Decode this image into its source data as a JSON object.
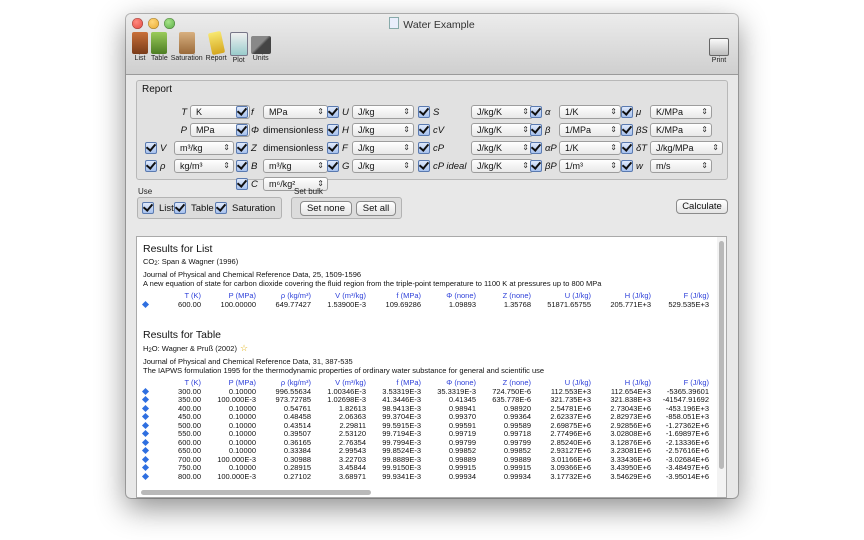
{
  "window": {
    "title": "Water Example"
  },
  "toolbar": {
    "items": [
      {
        "label": "List",
        "icon": "list-icon"
      },
      {
        "label": "Table",
        "icon": "table-icon"
      },
      {
        "label": "Saturation",
        "icon": "saturation-icon"
      },
      {
        "label": "Report",
        "icon": "report-icon"
      },
      {
        "label": "Plot",
        "icon": "plot-icon"
      },
      {
        "label": "Units",
        "icon": "units-icon"
      }
    ],
    "print_label": "Print"
  },
  "report": {
    "title": "Report",
    "T": {
      "label": "T",
      "unit": "K"
    },
    "P": {
      "label": "P",
      "unit": "MPa"
    },
    "V": {
      "label": "V",
      "unit": "m³/kg"
    },
    "rho": {
      "label": "ρ",
      "unit": "kg/m³"
    },
    "f": {
      "label": "f",
      "unit": "MPa"
    },
    "phi": {
      "label": "Φ",
      "text": "dimensionless"
    },
    "Z": {
      "label": "Z",
      "text": "dimensionless"
    },
    "B": {
      "label": "B",
      "unit": "m³/kg"
    },
    "C": {
      "label": "C",
      "unit": "m⁶/kg²"
    },
    "U": {
      "label": "U",
      "unit": "J/kg"
    },
    "H": {
      "label": "H",
      "unit": "J/kg"
    },
    "F": {
      "label": "F",
      "unit": "J/kg"
    },
    "G": {
      "label": "G",
      "unit": "J/kg"
    },
    "S": {
      "label": "S",
      "unit": "J/kg/K"
    },
    "cV": {
      "label": "cV",
      "unit": "J/kg/K"
    },
    "cP": {
      "label": "cP",
      "unit": "J/kg/K"
    },
    "cPideal": {
      "label": "cP ideal",
      "unit": "J/kg/K"
    },
    "alpha": {
      "label": "α",
      "unit": "1/K"
    },
    "beta": {
      "label": "β",
      "unit": "1/MPa"
    },
    "alphaP": {
      "label": "αP",
      "unit": "1/K"
    },
    "betaP": {
      "label": "βP",
      "unit": "1/m³"
    },
    "mu": {
      "label": "μ",
      "unit": "K/MPa"
    },
    "betaS": {
      "label": "βS",
      "unit": "K/MPa"
    },
    "deltaT": {
      "label": "δT",
      "unit": "J/kg/MPa"
    },
    "w": {
      "label": "w",
      "unit": "m/s"
    }
  },
  "use": {
    "title": "Use",
    "list": "List",
    "table": "Table",
    "saturation": "Saturation"
  },
  "setbulk": {
    "title": "Set bulk",
    "none": "Set none",
    "all": "Set all"
  },
  "calculate": "Calculate",
  "results": {
    "list": {
      "title": "Results for List",
      "formula_main": "CO",
      "formula_sub": "2",
      "source": ": Span & Wagner (1996)",
      "journal": "Journal of Physical and Chemical Reference Data, 25, 1509-1596",
      "description": "A new equation of state for carbon dioxide covering the fluid region from the triple-point temperature to 1100 K at pressures up to 800 MPa",
      "headers": [
        "T (K)",
        "P (MPa)",
        "ρ (kg/m³)",
        "V (m³/kg)",
        "f (MPa)",
        "Φ (none)",
        "Z (none)",
        "U (J/kg)",
        "H (J/kg)",
        "F (J/kg)"
      ],
      "rows": [
        [
          "600.00",
          "100.00000",
          "649.77427",
          "1.53900E-3",
          "109.69286",
          "1.09893",
          "1.35768",
          "51871.65755",
          "205.771E+3",
          "529.535E+3"
        ]
      ]
    },
    "table": {
      "title": "Results for Table",
      "formula_main": "H",
      "formula_sub": "2",
      "formula_tail": "O",
      "source": ": Wagner & Pruß (2002)",
      "journal": "Journal of Physical and Chemical Reference Data, 31, 387-535",
      "description": "The IAPWS formulation 1995 for the thermodynamic properties of ordinary water substance for general and scientific use",
      "headers": [
        "T (K)",
        "P (MPa)",
        "ρ (kg/m³)",
        "V (m³/kg)",
        "f (MPa)",
        "Φ (none)",
        "Z (none)",
        "U (J/kg)",
        "H (J/kg)",
        "F (J/kg)"
      ],
      "rows": [
        [
          "300.00",
          "0.10000",
          "996.55634",
          "1.00346E-3",
          "3.53319E-3",
          "35.3319E-3",
          "724.750E-6",
          "112.553E+3",
          "112.654E+3",
          "-5365.39601"
        ],
        [
          "350.00",
          "100.000E-3",
          "973.72785",
          "1.02698E-3",
          "41.3446E-3",
          "0.41345",
          "635.778E-6",
          "321.735E+3",
          "321.838E+3",
          "-41547.91692"
        ],
        [
          "400.00",
          "0.10000",
          "0.54761",
          "1.82613",
          "98.9413E-3",
          "0.98941",
          "0.98920",
          "2.54781E+6",
          "2.73043E+6",
          "-453.196E+3"
        ],
        [
          "450.00",
          "0.10000",
          "0.48458",
          "2.06363",
          "99.3704E-3",
          "0.99370",
          "0.99364",
          "2.62337E+6",
          "2.82973E+6",
          "-858.051E+3"
        ],
        [
          "500.00",
          "0.10000",
          "0.43514",
          "2.29811",
          "99.5915E-3",
          "0.99591",
          "0.99589",
          "2.69875E+6",
          "2.92856E+6",
          "-1.27362E+6"
        ],
        [
          "550.00",
          "0.10000",
          "0.39507",
          "2.53120",
          "99.7194E-3",
          "0.99719",
          "0.99718",
          "2.77496E+6",
          "3.02808E+6",
          "-1.69897E+6"
        ],
        [
          "600.00",
          "0.10000",
          "0.36165",
          "2.76354",
          "99.7994E-3",
          "0.99799",
          "0.99799",
          "2.85240E+6",
          "3.12876E+6",
          "-2.13336E+6"
        ],
        [
          "650.00",
          "0.10000",
          "0.33384",
          "2.99543",
          "99.8524E-3",
          "0.99852",
          "0.99852",
          "2.93127E+6",
          "3.23081E+6",
          "-2.57616E+6"
        ],
        [
          "700.00",
          "100.000E-3",
          "0.30988",
          "3.22703",
          "99.8889E-3",
          "0.99889",
          "0.99889",
          "3.01166E+6",
          "3.33436E+6",
          "-3.02684E+6"
        ],
        [
          "750.00",
          "0.10000",
          "0.28915",
          "3.45844",
          "99.9150E-3",
          "0.99915",
          "0.99915",
          "3.09366E+6",
          "3.43950E+6",
          "-3.48497E+6"
        ],
        [
          "800.00",
          "100.000E-3",
          "0.27102",
          "3.68971",
          "99.9341E-3",
          "0.99934",
          "0.99934",
          "3.17732E+6",
          "3.54629E+6",
          "-3.95014E+6"
        ]
      ]
    }
  }
}
